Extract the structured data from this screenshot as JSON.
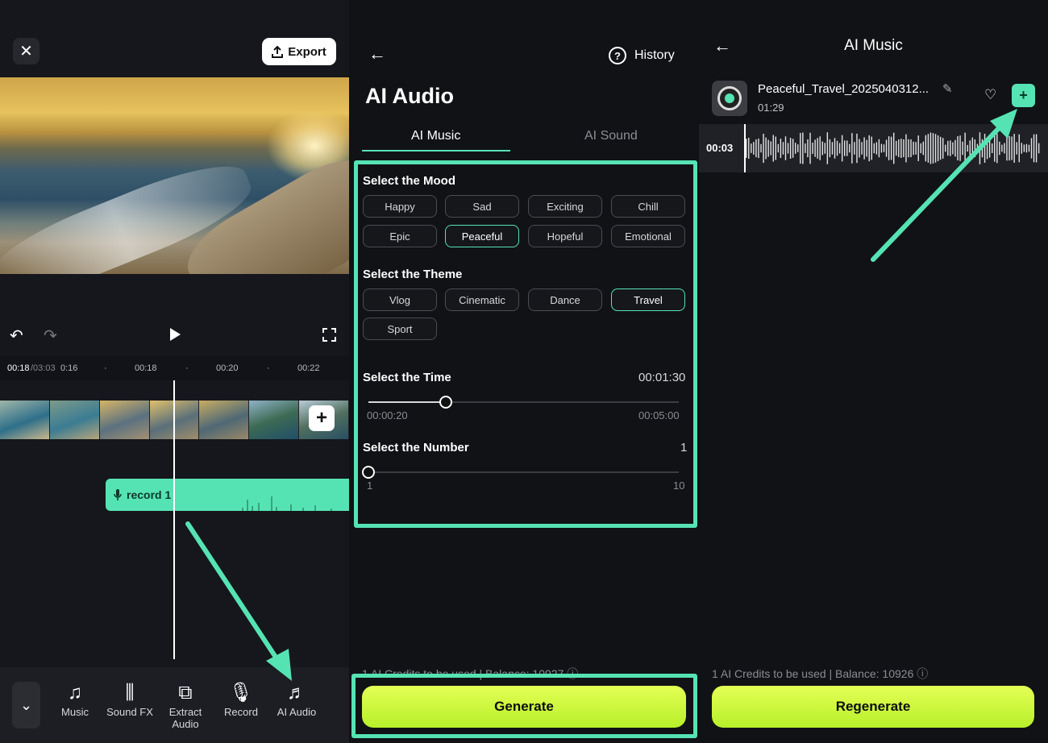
{
  "editor": {
    "close_glyph": "✕",
    "export_label": "Export",
    "ruler": {
      "current": "00:18",
      "total": "/03:03",
      "overlap": "0:16",
      "ticks": [
        "00:18",
        "00:20",
        "00:22"
      ],
      "dots": [
        "·",
        "·",
        "·"
      ]
    },
    "audio_track_label": "record 1",
    "toolbar": {
      "collapse_glyph": "⌄",
      "items": [
        {
          "label": "Music",
          "icon": "music-note-icon",
          "glyph": "♫"
        },
        {
          "label": "Sound FX",
          "icon": "sound-fx-icon",
          "glyph": "⫼"
        },
        {
          "label": "Extract\nAudio",
          "icon": "extract-audio-icon",
          "glyph": "⧉"
        },
        {
          "label": "Record",
          "icon": "microphone-icon",
          "glyph": "🎙"
        },
        {
          "label": "AI Audio",
          "icon": "ai-audio-icon",
          "glyph": "♬"
        }
      ]
    }
  },
  "ai_audio": {
    "back_glyph": "←",
    "history_label": "History",
    "title": "AI Audio",
    "tabs": [
      {
        "label": "AI Music",
        "active": true
      },
      {
        "label": "AI Sound",
        "active": false
      }
    ],
    "mood": {
      "title": "Select the Mood",
      "options": [
        "Happy",
        "Sad",
        "Exciting",
        "Chill",
        "Epic",
        "Peaceful",
        "Hopeful",
        "Emotional"
      ],
      "selected": "Peaceful"
    },
    "theme": {
      "title": "Select the Theme",
      "options": [
        "Vlog",
        "Cinematic",
        "Dance",
        "Travel",
        "Sport"
      ],
      "selected": "Travel"
    },
    "time": {
      "title": "Select the Time",
      "value": "00:01:30",
      "min_label": "00:00:20",
      "max_label": "00:05:00",
      "fraction": 0.25
    },
    "number": {
      "title": "Select the Number",
      "value": "1",
      "min_label": "1",
      "max_label": "10",
      "fraction": 0.0
    },
    "credits_text": "1 AI Credits to be used |  Balance: 10927 ⓘ",
    "generate_label": "Generate"
  },
  "ai_music": {
    "back_glyph": "←",
    "title": "AI Music",
    "song": {
      "name": "Peaceful_Travel_2025040312...",
      "duration": "01:29",
      "edit_glyph": "✎",
      "heart_glyph": "♡",
      "add_glyph": "+"
    },
    "waveform_time": "00:03",
    "credits_text": "1 AI Credits to be used |  Balance: 10926 ⓘ",
    "regenerate_label": "Regenerate"
  },
  "colors": {
    "accent": "#56e3b3",
    "button_lime": "#c8f53a",
    "background": "#101216"
  }
}
